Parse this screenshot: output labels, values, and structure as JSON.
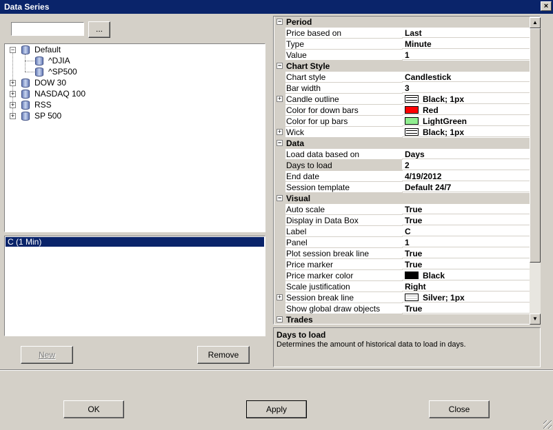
{
  "window": {
    "title": "Data Series",
    "close_glyph": "×"
  },
  "search": {
    "value": "",
    "browse_label": "..."
  },
  "tree": {
    "nodes": [
      {
        "label": "Default",
        "expander": "−"
      },
      {
        "label": "^DJIA"
      },
      {
        "label": "^SP500"
      },
      {
        "label": "DOW 30",
        "expander": "+"
      },
      {
        "label": "NASDAQ 100",
        "expander": "+"
      },
      {
        "label": "RSS",
        "expander": "+"
      },
      {
        "label": "SP 500",
        "expander": "+"
      }
    ]
  },
  "series_list": {
    "items": [
      {
        "label": "C (1 Min)",
        "selected": true
      }
    ]
  },
  "buttons": {
    "new": "New",
    "remove": "Remove",
    "ok": "OK",
    "apply": "Apply",
    "close": "Close"
  },
  "grid": {
    "categories": {
      "period": "Period",
      "chart_style": "Chart Style",
      "data": "Data",
      "visual": "Visual",
      "trades": "Trades"
    },
    "props": {
      "price_based_on": {
        "name": "Price based on",
        "value": "Last"
      },
      "type": {
        "name": "Type",
        "value": "Minute"
      },
      "value": {
        "name": "Value",
        "value": "1"
      },
      "chart_style": {
        "name": "Chart style",
        "value": "Candlestick"
      },
      "bar_width": {
        "name": "Bar width",
        "value": "3"
      },
      "candle_outline": {
        "name": "Candle outline",
        "value": "Black; 1px"
      },
      "color_down": {
        "name": "Color for down bars",
        "value": "Red",
        "color": "#ff0000"
      },
      "color_up": {
        "name": "Color for up bars",
        "value": "LightGreen",
        "color": "#90ee90"
      },
      "wick": {
        "name": "Wick",
        "value": "Black; 1px"
      },
      "load_based_on": {
        "name": "Load data based on",
        "value": "Days"
      },
      "days_to_load": {
        "name": "Days to load",
        "value": "2"
      },
      "end_date": {
        "name": "End date",
        "value": "4/19/2012"
      },
      "session_template": {
        "name": "Session template",
        "value": "Default 24/7"
      },
      "auto_scale": {
        "name": "Auto scale",
        "value": "True"
      },
      "display_data_box": {
        "name": "Display in Data Box",
        "value": "True"
      },
      "label": {
        "name": "Label",
        "value": "C"
      },
      "panel": {
        "name": "Panel",
        "value": "1"
      },
      "plot_session_break": {
        "name": "Plot session break line",
        "value": "True"
      },
      "price_marker": {
        "name": "Price marker",
        "value": "True"
      },
      "price_marker_color": {
        "name": "Price marker color",
        "value": "Black",
        "color": "#000000"
      },
      "scale_justification": {
        "name": "Scale justification",
        "value": "Right"
      },
      "session_break_line": {
        "name": "Session break line",
        "value": "Silver; 1px"
      },
      "show_global_draw": {
        "name": "Show global draw objects",
        "value": "True"
      }
    },
    "expand_glyph": "+",
    "collapse_glyph": "−"
  },
  "help": {
    "title": "Days to load",
    "description": "Determines the amount of historical data to load in days."
  },
  "scrollbar": {
    "up": "▲",
    "down": "▼"
  }
}
